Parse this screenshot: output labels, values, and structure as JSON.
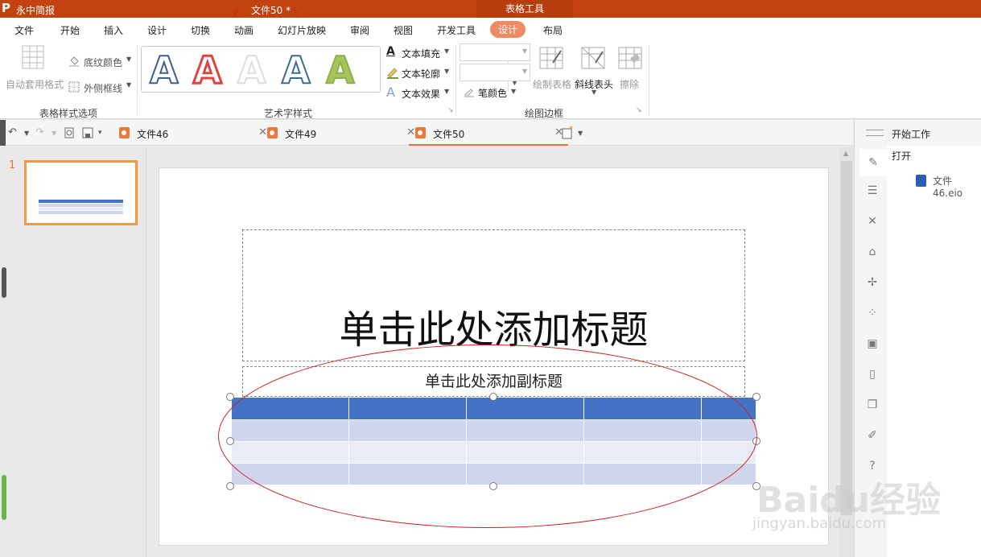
{
  "titlebar": {
    "logo": "P",
    "app_name": "永中简报",
    "doc_title": "文件50 *",
    "context_tools": "表格工具"
  },
  "menu": [
    "文件",
    "开始",
    "插入",
    "设计",
    "切换",
    "动画",
    "幻灯片放映",
    "审阅",
    "视图",
    "开发工具",
    "设计",
    "布局"
  ],
  "menu_active_index": 10,
  "ribbon": {
    "auto_format": "自动套用格式",
    "shading_color": "底纹颜色",
    "outer_border": "外侧框线",
    "group_table_style": "表格样式选项",
    "art_letters": [
      "A",
      "A",
      "A",
      "A",
      "A"
    ],
    "art_colors": [
      "#3f5f8c",
      "#e0443e",
      "#dddddd",
      "#3f6a98",
      "#8db04a"
    ],
    "text_fill": "文本填充",
    "text_outline": "文本轮廓",
    "text_effect": "文本效果",
    "group_art_style": "艺术字样式",
    "pen_color": "笔颜色",
    "draw_table": "绘制表格",
    "diag_header": "斜线表头",
    "erase": "擦除",
    "group_draw_border": "绘图边框"
  },
  "tabs": [
    {
      "label": "文件46"
    },
    {
      "label": "文件49"
    },
    {
      "label": "文件50"
    }
  ],
  "active_tab_index": 2,
  "thumbnails": {
    "slide_number": "1"
  },
  "slide": {
    "title_placeholder": "单击此处添加标题",
    "subtitle_placeholder": "单击此处添加副标题",
    "table": {
      "rows": 4,
      "cols": 5,
      "header_color": "#4472c4",
      "band_colors": [
        "#cfd5ea",
        "#e9ebf5"
      ]
    }
  },
  "right_panel": {
    "title": "开始工作",
    "open_label": "打开",
    "recent_file": "文件46.eio"
  },
  "watermark": {
    "brand": "Baidu经验",
    "url": "jingyan.baidu.com"
  }
}
